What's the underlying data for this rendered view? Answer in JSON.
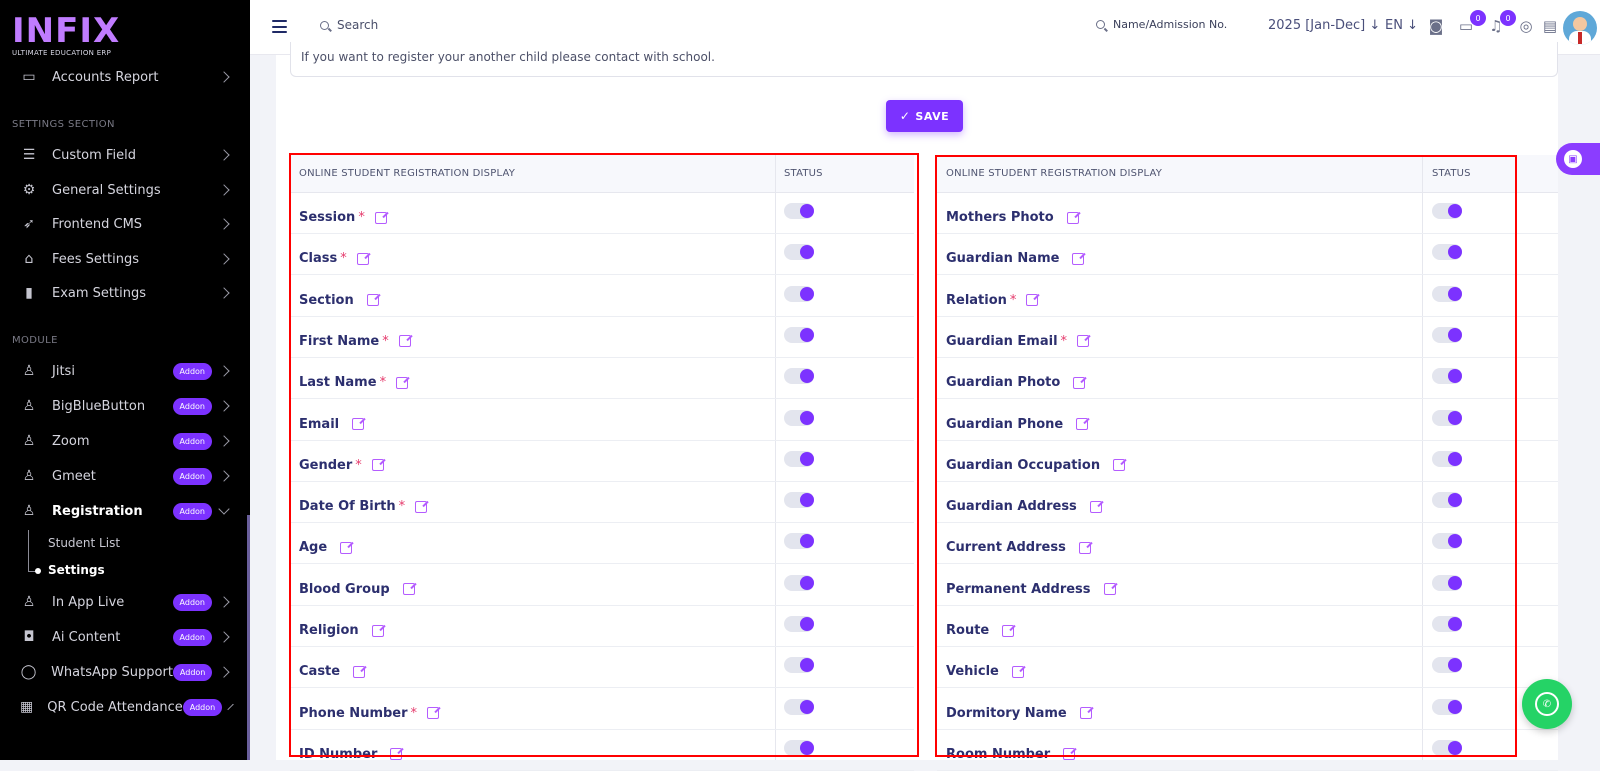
{
  "brand": {
    "logo_text": "INFIX",
    "tagline": "ULTIMATE EDUCATION ERP"
  },
  "sidebar": {
    "top_item": {
      "label": "Accounts Report",
      "icon": "money-icon"
    },
    "settings_section_title": "SETTINGS SECTION",
    "settings_items": [
      {
        "label": "Custom Field",
        "icon": "custom-field-icon"
      },
      {
        "label": "General Settings",
        "icon": "gears-icon"
      },
      {
        "label": "Frontend CMS",
        "icon": "rocket-icon"
      },
      {
        "label": "Fees Settings",
        "icon": "bank-icon"
      },
      {
        "label": "Exam Settings",
        "icon": "book-icon"
      }
    ],
    "module_section_title": "MODULE",
    "module_items": [
      {
        "label": "Jitsi",
        "badge": "Addon",
        "icon": "module-icon"
      },
      {
        "label": "BigBlueButton",
        "badge": "Addon",
        "icon": "module-icon"
      },
      {
        "label": "Zoom",
        "badge": "Addon",
        "icon": "module-icon"
      },
      {
        "label": "Gmeet",
        "badge": "Addon",
        "icon": "module-icon"
      },
      {
        "label": "Registration",
        "badge": "Addon",
        "icon": "module-icon"
      },
      {
        "label": "In App Live",
        "badge": "Addon",
        "icon": "module-icon"
      },
      {
        "label": "Ai Content",
        "badge": "Addon",
        "icon": "robot-icon"
      },
      {
        "label": "WhatsApp Support",
        "badge": "Addon",
        "icon": "whatsapp-icon"
      },
      {
        "label": "QR Code Attendance",
        "badge": "Addon",
        "icon": "qr-code-icon"
      }
    ],
    "registration_sub": [
      "Student List",
      "Settings"
    ]
  },
  "topbar": {
    "search_placeholder": "Search",
    "name_search": "Name/Admission No.",
    "academic_year": "2025 [Jan-Dec]",
    "language": "EN",
    "chat_count": "0",
    "notification_count": "0"
  },
  "main": {
    "note": "If you want to register your another child please contact with school.",
    "save_label": "SAVE",
    "left_table": {
      "header_field": "ONLINE STUDENT REGISTRATION DISPLAY",
      "header_status": "STATUS",
      "rows": [
        {
          "label": "Session",
          "required": "*",
          "enabled": true
        },
        {
          "label": "Class",
          "required": "*",
          "enabled": true
        },
        {
          "label": "Section",
          "required": "",
          "enabled": true
        },
        {
          "label": "First Name",
          "required": "*",
          "enabled": true
        },
        {
          "label": "Last Name",
          "required": "*",
          "enabled": true
        },
        {
          "label": "Email",
          "required": "",
          "enabled": true
        },
        {
          "label": "Gender",
          "required": "*",
          "enabled": true
        },
        {
          "label": "Date Of Birth",
          "required": "*",
          "enabled": true
        },
        {
          "label": "Age",
          "required": "",
          "enabled": true
        },
        {
          "label": "Blood Group",
          "required": "",
          "enabled": true
        },
        {
          "label": "Religion",
          "required": "",
          "enabled": true
        },
        {
          "label": "Caste",
          "required": "",
          "enabled": true
        },
        {
          "label": "Phone Number",
          "required": "*",
          "enabled": true
        },
        {
          "label": "ID Number",
          "required": "",
          "enabled": true
        }
      ]
    },
    "right_table": {
      "header_field": "ONLINE STUDENT REGISTRATION DISPLAY",
      "header_status": "STATUS",
      "rows": [
        {
          "label": "Mothers Photo",
          "required": "",
          "enabled": true
        },
        {
          "label": "Guardian Name",
          "required": "",
          "enabled": true
        },
        {
          "label": "Relation",
          "required": "*",
          "enabled": true
        },
        {
          "label": "Guardian Email",
          "required": "*",
          "enabled": true
        },
        {
          "label": "Guardian Photo",
          "required": "",
          "enabled": true
        },
        {
          "label": "Guardian Phone",
          "required": "",
          "enabled": true
        },
        {
          "label": "Guardian Occupation",
          "required": "",
          "enabled": true
        },
        {
          "label": "Guardian Address",
          "required": "",
          "enabled": true
        },
        {
          "label": "Current Address",
          "required": "",
          "enabled": true
        },
        {
          "label": "Permanent Address",
          "required": "",
          "enabled": true
        },
        {
          "label": "Route",
          "required": "",
          "enabled": true
        },
        {
          "label": "Vehicle",
          "required": "",
          "enabled": true
        },
        {
          "label": "Dormitory Name",
          "required": "",
          "enabled": true
        },
        {
          "label": "Room Number",
          "required": "",
          "enabled": true
        }
      ]
    }
  },
  "colors": {
    "accent": "#7c32ff",
    "sidebar_bg": "#000000",
    "label": "#2c2f6e",
    "required": "#e5396b",
    "highlight": "#ff0000",
    "whatsapp": "#25d366"
  }
}
